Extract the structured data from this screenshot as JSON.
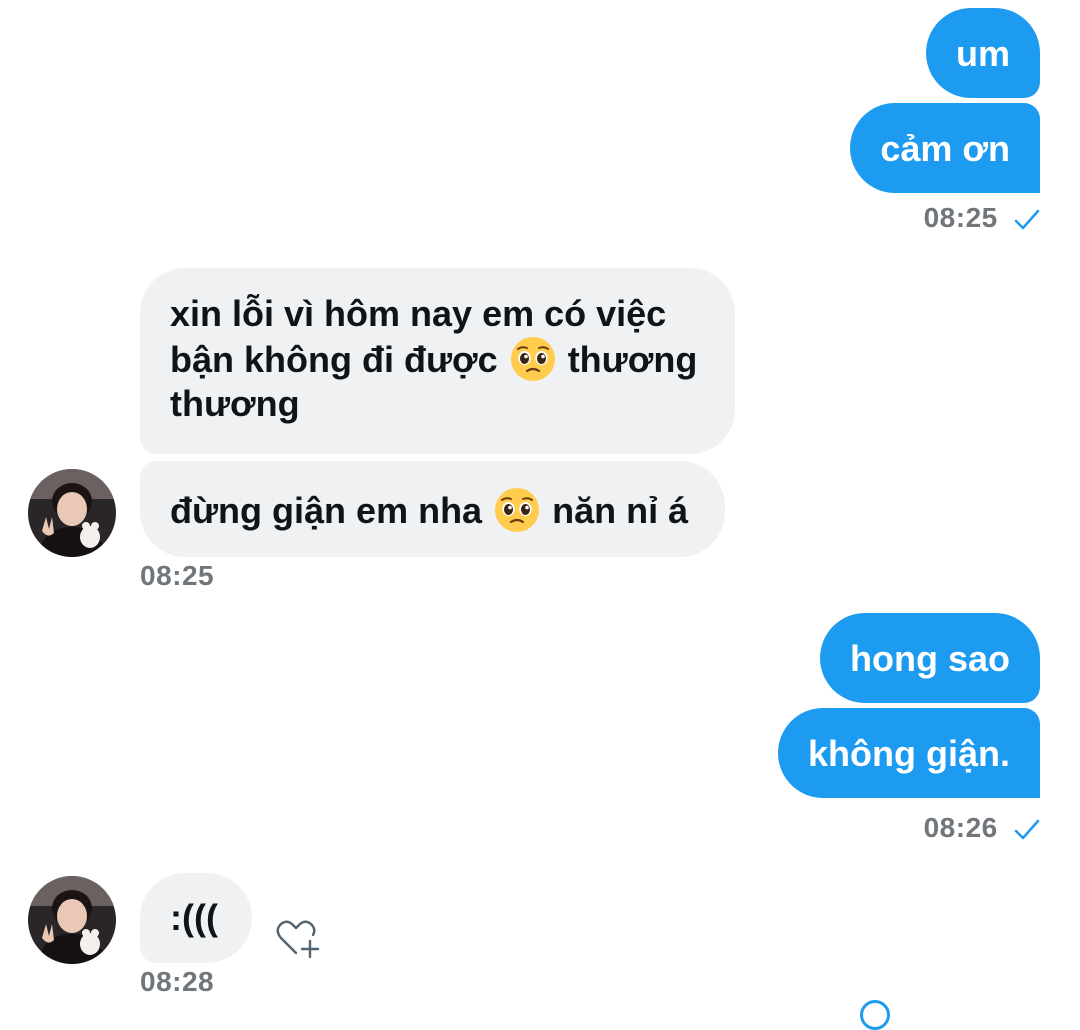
{
  "conversation": {
    "out_group_1": {
      "messages": [
        "um",
        "cảm ơn"
      ],
      "time": "08:25"
    },
    "in_group_1": {
      "messages": [
        {
          "before": "xin lỗi vì hôm nay em có việc bận không đi được",
          "emoji": "pleading-face",
          "after": "thương thương"
        },
        {
          "before": "đừng giận em nha",
          "emoji": "pleading-face",
          "after": "năn nỉ á"
        }
      ],
      "time": "08:25"
    },
    "out_group_2": {
      "messages": [
        "hong sao",
        "không giận."
      ],
      "time": "08:26"
    },
    "in_group_2": {
      "messages": [
        ":((("
      ],
      "time": "08:28"
    }
  },
  "colors": {
    "outgoing_bubble": "#1d9bf0",
    "incoming_bubble": "#eff1f3",
    "timestamp": "#71767b",
    "read_check": "#1d9bf0"
  },
  "icons": {
    "read_receipt": "checkmark-icon",
    "react": "heart-plus-icon",
    "avatar": "user-avatar"
  }
}
